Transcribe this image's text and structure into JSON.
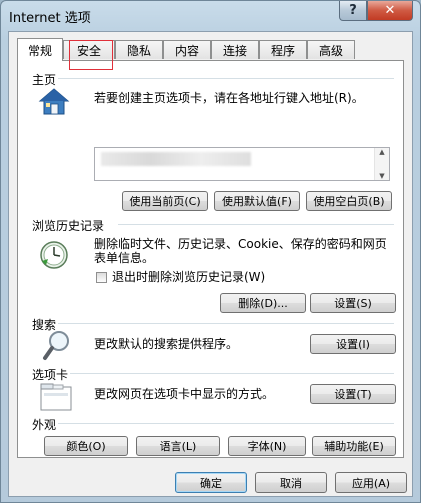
{
  "window": {
    "title": "Internet 选项",
    "help_glyph": "?",
    "close_glyph": "✕"
  },
  "tabs": [
    {
      "label": "常规",
      "active": true
    },
    {
      "label": "安全"
    },
    {
      "label": "隐私"
    },
    {
      "label": "内容"
    },
    {
      "label": "连接"
    },
    {
      "label": "程序"
    },
    {
      "label": "高级"
    }
  ],
  "home": {
    "title": "主页",
    "description": "若要创建主页选项卡，请在各地址行键入地址(R)。",
    "use_current": "使用当前页(C)",
    "use_default": "使用默认值(F)",
    "use_blank": "使用空白页(B)"
  },
  "history": {
    "title": "浏览历史记录",
    "description_line1": "删除临时文件、历史记录、Cookie、保存的密码和网页",
    "description_line2": "表单信息。",
    "checkbox_label": "退出时删除浏览历史记录(W)",
    "checkbox_checked": false,
    "delete_button": "删除(D)...",
    "settings_button": "设置(S)"
  },
  "search": {
    "title": "搜索",
    "description": "更改默认的搜索提供程序。",
    "settings_button": "设置(I)"
  },
  "tabs_section": {
    "title": "选项卡",
    "description": "更改网页在选项卡中显示的方式。",
    "settings_button": "设置(T)"
  },
  "appearance": {
    "title": "外观",
    "colors": "颜色(O)",
    "languages": "语言(L)",
    "fonts": "字体(N)",
    "accessibility": "辅助功能(E)"
  },
  "footer": {
    "ok": "确定",
    "cancel": "取消",
    "apply": "应用(A)"
  }
}
